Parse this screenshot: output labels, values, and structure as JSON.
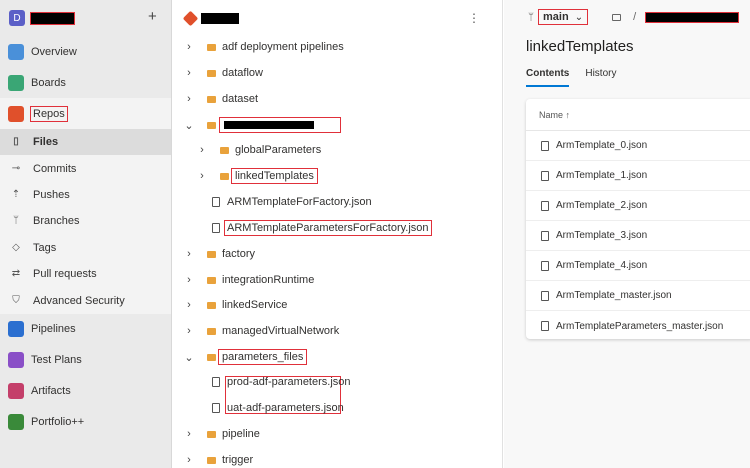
{
  "sidebar": {
    "avatar_letter": "D",
    "add_symbol": "+",
    "items": [
      {
        "label": "Overview",
        "icon": "overview-icon",
        "color": "#4a90d9"
      },
      {
        "label": "Boards",
        "icon": "boards-icon",
        "color": "#3aa675"
      },
      {
        "label": "Repos",
        "icon": "repos-icon",
        "color": "#e0502b"
      }
    ],
    "repo_subitems": [
      {
        "label": "Files",
        "icon": "files-icon"
      },
      {
        "label": "Commits",
        "icon": "commits-icon"
      },
      {
        "label": "Pushes",
        "icon": "pushes-icon"
      },
      {
        "label": "Branches",
        "icon": "branches-icon"
      },
      {
        "label": "Tags",
        "icon": "tags-icon"
      },
      {
        "label": "Pull requests",
        "icon": "pull-requests-icon"
      },
      {
        "label": "Advanced Security",
        "icon": "shield-icon"
      }
    ],
    "lower_items": [
      {
        "label": "Pipelines",
        "icon": "pipelines-icon",
        "color": "#2b6fd0"
      },
      {
        "label": "Test Plans",
        "icon": "test-plans-icon",
        "color": "#8a4fc7"
      },
      {
        "label": "Artifacts",
        "icon": "artifacts-icon",
        "color": "#c43f6a"
      },
      {
        "label": "Portfolio++",
        "icon": "portfolio-icon",
        "color": "#3a8a3a"
      }
    ]
  },
  "tree": {
    "kebab": "⋮",
    "rows": [
      {
        "label": "adf deployment pipelines",
        "type": "folder",
        "expanded": false
      },
      {
        "label": "dataflow",
        "type": "folder",
        "expanded": false
      },
      {
        "label": "dataset",
        "type": "folder",
        "expanded": false
      },
      {
        "label": "",
        "type": "folder",
        "expanded": true
      },
      {
        "label": "globalParameters",
        "type": "folder",
        "expanded": false
      },
      {
        "label": "linkedTemplates",
        "type": "folder",
        "expanded": false
      },
      {
        "label": "ARMTemplateForFactory.json",
        "type": "file"
      },
      {
        "label": "ARMTemplateParametersForFactory.json",
        "type": "file"
      },
      {
        "label": "factory",
        "type": "folder",
        "expanded": false
      },
      {
        "label": "integrationRuntime",
        "type": "folder",
        "expanded": false
      },
      {
        "label": "linkedService",
        "type": "folder",
        "expanded": false
      },
      {
        "label": "managedVirtualNetwork",
        "type": "folder",
        "expanded": false
      },
      {
        "label": "parameters_files",
        "type": "folder",
        "expanded": true
      },
      {
        "label": "prod-adf-parameters.json",
        "type": "file"
      },
      {
        "label": "uat-adf-parameters.json",
        "type": "file"
      },
      {
        "label": "pipeline",
        "type": "folder",
        "expanded": false
      },
      {
        "label": "trigger",
        "type": "folder",
        "expanded": false
      }
    ]
  },
  "right": {
    "branch": "main",
    "path_separator": "/",
    "title": "linkedTemplates",
    "tabs": [
      "Contents",
      "History"
    ],
    "column_header": "Name ↑",
    "files": [
      "ArmTemplate_0.json",
      "ArmTemplate_1.json",
      "ArmTemplate_2.json",
      "ArmTemplate_3.json",
      "ArmTemplate_4.json",
      "ArmTemplate_master.json",
      "ArmTemplateParameters_master.json"
    ]
  }
}
